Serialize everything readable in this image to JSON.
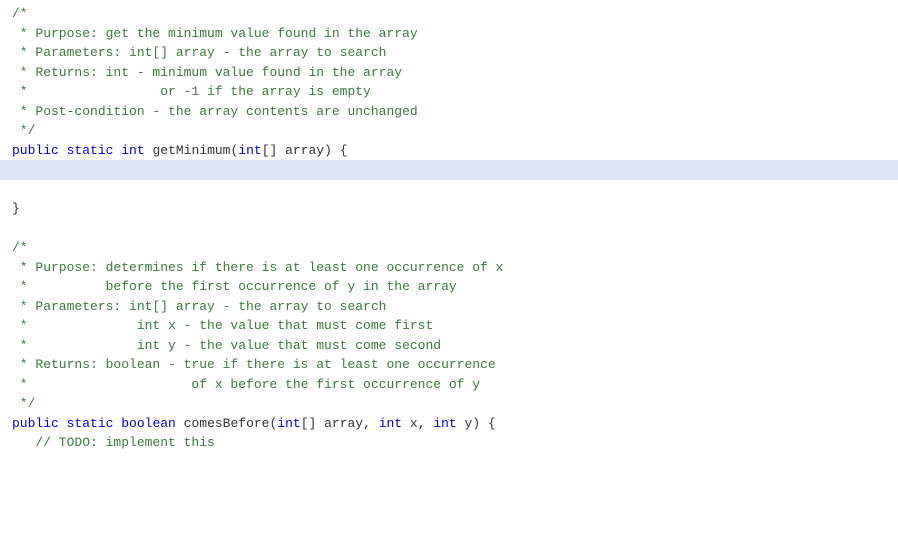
{
  "code": {
    "lines": [
      {
        "id": 1,
        "highlighted": false,
        "tokens": [
          {
            "text": "/*",
            "color": "green"
          }
        ]
      },
      {
        "id": 2,
        "highlighted": false,
        "tokens": [
          {
            "text": " * Purpose: get the minimum value found in the array",
            "color": "green"
          }
        ]
      },
      {
        "id": 3,
        "highlighted": false,
        "tokens": [
          {
            "text": " * Parameters: int[] array - the array to search",
            "color": "green"
          }
        ]
      },
      {
        "id": 4,
        "highlighted": false,
        "tokens": [
          {
            "text": " * Returns: int - minimum value found in the array",
            "color": "green"
          }
        ]
      },
      {
        "id": 5,
        "highlighted": false,
        "tokens": [
          {
            "text": " *                 or -1 if the array is empty",
            "color": "green"
          }
        ]
      },
      {
        "id": 6,
        "highlighted": false,
        "tokens": [
          {
            "text": " * Post-condition - the array contents are unchanged",
            "color": "green"
          }
        ]
      },
      {
        "id": 7,
        "highlighted": false,
        "tokens": [
          {
            "text": " */",
            "color": "green"
          }
        ]
      },
      {
        "id": 8,
        "highlighted": false,
        "tokens": [
          {
            "text": "public",
            "color": "blue"
          },
          {
            "text": " ",
            "color": "black"
          },
          {
            "text": "static",
            "color": "blue"
          },
          {
            "text": " ",
            "color": "black"
          },
          {
            "text": "int",
            "color": "blue"
          },
          {
            "text": " getMinimum(",
            "color": "black"
          },
          {
            "text": "int",
            "color": "blue"
          },
          {
            "text": "[] array) {",
            "color": "black"
          }
        ]
      },
      {
        "id": 9,
        "highlighted": true,
        "tokens": [
          {
            "text": "",
            "color": "black"
          }
        ]
      },
      {
        "id": 10,
        "highlighted": false,
        "tokens": [
          {
            "text": "",
            "color": "black"
          }
        ]
      },
      {
        "id": 11,
        "highlighted": false,
        "tokens": [
          {
            "text": "}",
            "color": "black"
          }
        ]
      },
      {
        "id": 12,
        "highlighted": false,
        "tokens": [
          {
            "text": "",
            "color": "black"
          }
        ]
      },
      {
        "id": 13,
        "highlighted": false,
        "tokens": [
          {
            "text": "/*",
            "color": "green"
          }
        ]
      },
      {
        "id": 14,
        "highlighted": false,
        "tokens": [
          {
            "text": " * Purpose: determines if there is at least one occurrence of x",
            "color": "green"
          }
        ]
      },
      {
        "id": 15,
        "highlighted": false,
        "tokens": [
          {
            "text": " *          before the first occurrence of y in the array",
            "color": "green"
          }
        ]
      },
      {
        "id": 16,
        "highlighted": false,
        "tokens": [
          {
            "text": " * Parameters: int[] array - the array to search",
            "color": "green"
          }
        ]
      },
      {
        "id": 17,
        "highlighted": false,
        "tokens": [
          {
            "text": " *              int x - the value that must come first",
            "color": "green"
          }
        ]
      },
      {
        "id": 18,
        "highlighted": false,
        "tokens": [
          {
            "text": " *              int y - the value that must come second",
            "color": "green"
          }
        ]
      },
      {
        "id": 19,
        "highlighted": false,
        "tokens": [
          {
            "text": " * Returns: boolean - true if there is at least one occurrence",
            "color": "green"
          }
        ]
      },
      {
        "id": 20,
        "highlighted": false,
        "tokens": [
          {
            "text": " *                     of x before the first occurrence of y",
            "color": "green"
          }
        ]
      },
      {
        "id": 21,
        "highlighted": false,
        "tokens": [
          {
            "text": " */",
            "color": "green"
          }
        ]
      },
      {
        "id": 22,
        "highlighted": false,
        "tokens": [
          {
            "text": "public",
            "color": "blue"
          },
          {
            "text": " ",
            "color": "black"
          },
          {
            "text": "static",
            "color": "blue"
          },
          {
            "text": " ",
            "color": "black"
          },
          {
            "text": "boolean",
            "color": "blue"
          },
          {
            "text": " comesBefore(",
            "color": "black"
          },
          {
            "text": "int",
            "color": "blue"
          },
          {
            "text": "[] array, ",
            "color": "black"
          },
          {
            "text": "int",
            "color": "blue"
          },
          {
            "text": " x, ",
            "color": "black"
          },
          {
            "text": "int",
            "color": "blue"
          },
          {
            "text": " y) {",
            "color": "black"
          }
        ]
      },
      {
        "id": 23,
        "highlighted": false,
        "tokens": [
          {
            "text": "   // TODO: implement this",
            "color": "green"
          }
        ]
      }
    ]
  }
}
